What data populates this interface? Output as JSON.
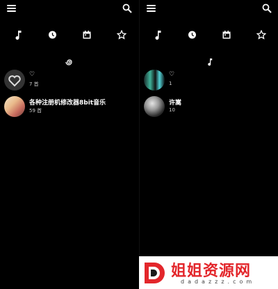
{
  "icons": {
    "menu": "hamburger-icon",
    "search": "search-icon",
    "tabs": [
      "music-note-icon",
      "history-icon",
      "calendar-icon",
      "star-icon"
    ]
  },
  "left_panel": {
    "section_icon": "spiral-icon",
    "items": [
      {
        "title": "♡",
        "subtitle": "7 首"
      },
      {
        "title": "各种注册机修改器8bit音乐",
        "subtitle": "59 首"
      }
    ]
  },
  "right_panel": {
    "section_icon": "music-note-icon",
    "items": [
      {
        "title": "♡",
        "subtitle": "1"
      },
      {
        "title": "许嵩",
        "subtitle": "10"
      }
    ]
  },
  "watermark": {
    "title": "姐姐资源网",
    "subtitle": "dadazzz.com"
  },
  "colors": {
    "background": "#000000",
    "text": "#ffffff",
    "watermark_red": "#e3262b"
  }
}
